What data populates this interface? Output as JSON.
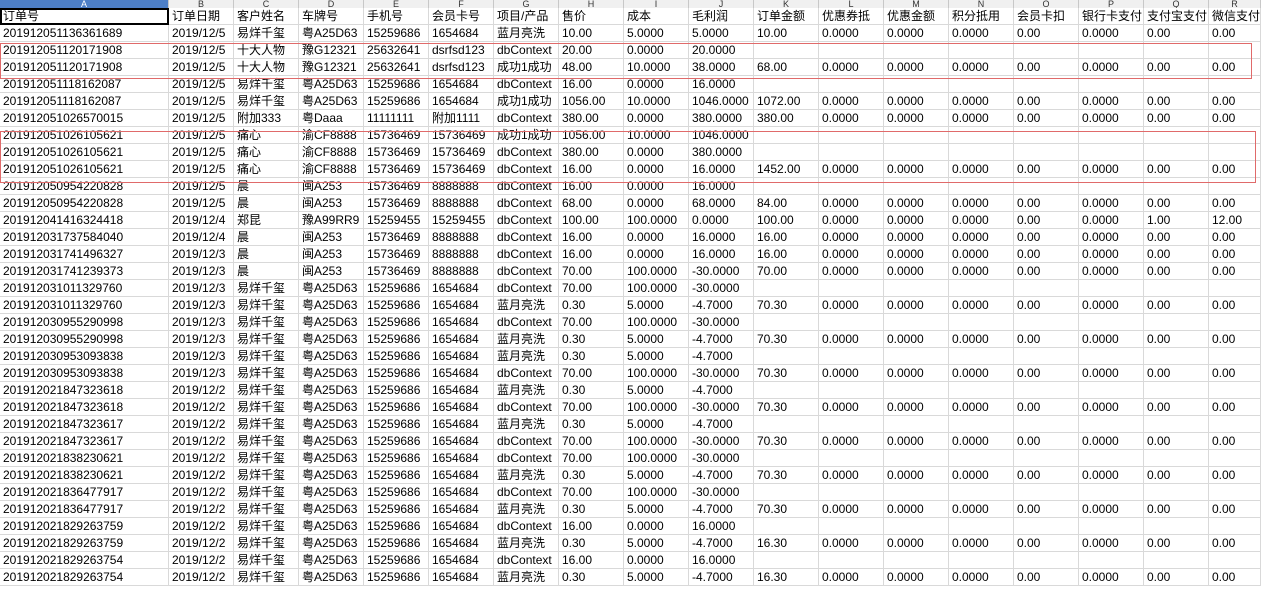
{
  "column_letters": [
    "A",
    "B",
    "C",
    "D",
    "E",
    "F",
    "G",
    "H",
    "I",
    "J",
    "K",
    "L",
    "M",
    "N",
    "O",
    "P",
    "Q",
    "R"
  ],
  "header_row": [
    "订单号",
    "订单日期",
    "客户姓名",
    "车牌号",
    "手机号",
    "会员卡号",
    "项目/产品",
    "售价",
    "成本",
    "毛利润",
    "订单金额",
    "优惠券抵",
    "优惠金额",
    "积分抵用",
    "会员卡扣",
    "银行卡支付",
    "支付宝支付",
    "微信支付"
  ],
  "rows": [
    [
      "201912051136361689",
      "2019/12/5",
      "易烊千玺",
      "粤A25D63",
      "15259686",
      "1654684",
      "蓝月亮洗",
      "10.00",
      "5.0000",
      "5.0000",
      "10.00",
      "0.0000",
      "0.0000",
      "0.0000",
      "0.00",
      "0.0000",
      "0.00",
      "0.00"
    ],
    [
      "201912051120171908",
      "2019/12/5",
      "十大人物",
      "豫G12321",
      "25632641",
      "dsrfsd123",
      "dbContext",
      "20.00",
      "0.0000",
      "20.0000",
      "",
      "",
      "",
      "",
      "",
      "",
      "",
      ""
    ],
    [
      "201912051120171908",
      "2019/12/5",
      "十大人物",
      "豫G12321",
      "25632641",
      "dsrfsd123",
      "成功1成功",
      "48.00",
      "10.0000",
      "38.0000",
      "68.00",
      "0.0000",
      "0.0000",
      "0.0000",
      "0.00",
      "0.0000",
      "0.00",
      "0.00"
    ],
    [
      "201912051118162087",
      "2019/12/5",
      "易烊千玺",
      "粤A25D63",
      "15259686",
      "1654684",
      "dbContext",
      "16.00",
      "0.0000",
      "16.0000",
      "",
      "",
      "",
      "",
      "",
      "",
      "",
      ""
    ],
    [
      "201912051118162087",
      "2019/12/5",
      "易烊千玺",
      "粤A25D63",
      "15259686",
      "1654684",
      "成功1成功",
      "1056.00",
      "10.0000",
      "1046.0000",
      "1072.00",
      "0.0000",
      "0.0000",
      "0.0000",
      "0.00",
      "0.0000",
      "0.00",
      "0.00"
    ],
    [
      "201912051026570015",
      "2019/12/5",
      "附加333",
      "粤Daaa",
      "11111111",
      "附加1111",
      "dbContext",
      "380.00",
      "0.0000",
      "380.0000",
      "380.00",
      "0.0000",
      "0.0000",
      "0.0000",
      "0.00",
      "0.0000",
      "0.00",
      "0.00"
    ],
    [
      "201912051026105621",
      "2019/12/5",
      "痛心",
      "渝CF8888",
      "15736469",
      "15736469",
      "成功1成功",
      "1056.00",
      "10.0000",
      "1046.0000",
      "",
      "",
      "",
      "",
      "",
      "",
      "",
      ""
    ],
    [
      "201912051026105621",
      "2019/12/5",
      "痛心",
      "渝CF8888",
      "15736469",
      "15736469",
      "dbContext",
      "380.00",
      "0.0000",
      "380.0000",
      "",
      "",
      "",
      "",
      "",
      "",
      "",
      ""
    ],
    [
      "201912051026105621",
      "2019/12/5",
      "痛心",
      "渝CF8888",
      "15736469",
      "15736469",
      "dbContext",
      "16.00",
      "0.0000",
      "16.0000",
      "1452.00",
      "0.0000",
      "0.0000",
      "0.0000",
      "0.00",
      "0.0000",
      "0.00",
      "0.00"
    ],
    [
      "201912050954220828",
      "2019/12/5",
      "晨",
      "闽A253",
      "15736469",
      "8888888",
      "dbContext",
      "16.00",
      "0.0000",
      "16.0000",
      "",
      "",
      "",
      "",
      "",
      "",
      "",
      ""
    ],
    [
      "201912050954220828",
      "2019/12/5",
      "晨",
      "闽A253",
      "15736469",
      "8888888",
      "dbContext",
      "68.00",
      "0.0000",
      "68.0000",
      "84.00",
      "0.0000",
      "0.0000",
      "0.0000",
      "0.00",
      "0.0000",
      "0.00",
      "0.00"
    ],
    [
      "201912041416324418",
      "2019/12/4",
      "郑昆",
      "豫A99RR9",
      "15259455",
      "15259455",
      "dbContext",
      "100.00",
      "100.0000",
      "0.0000",
      "100.00",
      "0.0000",
      "0.0000",
      "0.0000",
      "0.00",
      "0.0000",
      "1.00",
      "12.00"
    ],
    [
      "201912031737584040",
      "2019/12/4",
      "晨",
      "闽A253",
      "15736469",
      "8888888",
      "dbContext",
      "16.00",
      "0.0000",
      "16.0000",
      "16.00",
      "0.0000",
      "0.0000",
      "0.0000",
      "0.00",
      "0.0000",
      "0.00",
      "0.00"
    ],
    [
      "201912031741496327",
      "2019/12/3",
      "晨",
      "闽A253",
      "15736469",
      "8888888",
      "dbContext",
      "16.00",
      "0.0000",
      "16.0000",
      "16.00",
      "0.0000",
      "0.0000",
      "0.0000",
      "0.00",
      "0.0000",
      "0.00",
      "0.00"
    ],
    [
      "201912031741239373",
      "2019/12/3",
      "晨",
      "闽A253",
      "15736469",
      "8888888",
      "dbContext",
      "70.00",
      "100.0000",
      "-30.0000",
      "70.00",
      "0.0000",
      "0.0000",
      "0.0000",
      "0.00",
      "0.0000",
      "0.00",
      "0.00"
    ],
    [
      "201912031011329760",
      "2019/12/3",
      "易烊千玺",
      "粤A25D63",
      "15259686",
      "1654684",
      "dbContext",
      "70.00",
      "100.0000",
      "-30.0000",
      "",
      "",
      "",
      "",
      "",
      "",
      "",
      ""
    ],
    [
      "201912031011329760",
      "2019/12/3",
      "易烊千玺",
      "粤A25D63",
      "15259686",
      "1654684",
      "蓝月亮洗",
      "0.30",
      "5.0000",
      "-4.7000",
      "70.30",
      "0.0000",
      "0.0000",
      "0.0000",
      "0.00",
      "0.0000",
      "0.00",
      "0.00"
    ],
    [
      "201912030955290998",
      "2019/12/3",
      "易烊千玺",
      "粤A25D63",
      "15259686",
      "1654684",
      "dbContext",
      "70.00",
      "100.0000",
      "-30.0000",
      "",
      "",
      "",
      "",
      "",
      "",
      "",
      ""
    ],
    [
      "201912030955290998",
      "2019/12/3",
      "易烊千玺",
      "粤A25D63",
      "15259686",
      "1654684",
      "蓝月亮洗",
      "0.30",
      "5.0000",
      "-4.7000",
      "70.30",
      "0.0000",
      "0.0000",
      "0.0000",
      "0.00",
      "0.0000",
      "0.00",
      "0.00"
    ],
    [
      "201912030953093838",
      "2019/12/3",
      "易烊千玺",
      "粤A25D63",
      "15259686",
      "1654684",
      "蓝月亮洗",
      "0.30",
      "5.0000",
      "-4.7000",
      "",
      "",
      "",
      "",
      "",
      "",
      "",
      ""
    ],
    [
      "201912030953093838",
      "2019/12/3",
      "易烊千玺",
      "粤A25D63",
      "15259686",
      "1654684",
      "dbContext",
      "70.00",
      "100.0000",
      "-30.0000",
      "70.30",
      "0.0000",
      "0.0000",
      "0.0000",
      "0.00",
      "0.0000",
      "0.00",
      "0.00"
    ],
    [
      "201912021847323618",
      "2019/12/2",
      "易烊千玺",
      "粤A25D63",
      "15259686",
      "1654684",
      "蓝月亮洗",
      "0.30",
      "5.0000",
      "-4.7000",
      "",
      "",
      "",
      "",
      "",
      "",
      "",
      ""
    ],
    [
      "201912021847323618",
      "2019/12/2",
      "易烊千玺",
      "粤A25D63",
      "15259686",
      "1654684",
      "dbContext",
      "70.00",
      "100.0000",
      "-30.0000",
      "70.30",
      "0.0000",
      "0.0000",
      "0.0000",
      "0.00",
      "0.0000",
      "0.00",
      "0.00"
    ],
    [
      "201912021847323617",
      "2019/12/2",
      "易烊千玺",
      "粤A25D63",
      "15259686",
      "1654684",
      "蓝月亮洗",
      "0.30",
      "5.0000",
      "-4.7000",
      "",
      "",
      "",
      "",
      "",
      "",
      "",
      ""
    ],
    [
      "201912021847323617",
      "2019/12/2",
      "易烊千玺",
      "粤A25D63",
      "15259686",
      "1654684",
      "dbContext",
      "70.00",
      "100.0000",
      "-30.0000",
      "70.30",
      "0.0000",
      "0.0000",
      "0.0000",
      "0.00",
      "0.0000",
      "0.00",
      "0.00"
    ],
    [
      "201912021838230621",
      "2019/12/2",
      "易烊千玺",
      "粤A25D63",
      "15259686",
      "1654684",
      "dbContext",
      "70.00",
      "100.0000",
      "-30.0000",
      "",
      "",
      "",
      "",
      "",
      "",
      "",
      ""
    ],
    [
      "201912021838230621",
      "2019/12/2",
      "易烊千玺",
      "粤A25D63",
      "15259686",
      "1654684",
      "蓝月亮洗",
      "0.30",
      "5.0000",
      "-4.7000",
      "70.30",
      "0.0000",
      "0.0000",
      "0.0000",
      "0.00",
      "0.0000",
      "0.00",
      "0.00"
    ],
    [
      "201912021836477917",
      "2019/12/2",
      "易烊千玺",
      "粤A25D63",
      "15259686",
      "1654684",
      "dbContext",
      "70.00",
      "100.0000",
      "-30.0000",
      "",
      "",
      "",
      "",
      "",
      "",
      "",
      ""
    ],
    [
      "201912021836477917",
      "2019/12/2",
      "易烊千玺",
      "粤A25D63",
      "15259686",
      "1654684",
      "蓝月亮洗",
      "0.30",
      "5.0000",
      "-4.7000",
      "70.30",
      "0.0000",
      "0.0000",
      "0.0000",
      "0.00",
      "0.0000",
      "0.00",
      "0.00"
    ],
    [
      "201912021829263759",
      "2019/12/2",
      "易烊千玺",
      "粤A25D63",
      "15259686",
      "1654684",
      "dbContext",
      "16.00",
      "0.0000",
      "16.0000",
      "",
      "",
      "",
      "",
      "",
      "",
      "",
      ""
    ],
    [
      "201912021829263759",
      "2019/12/2",
      "易烊千玺",
      "粤A25D63",
      "15259686",
      "1654684",
      "蓝月亮洗",
      "0.30",
      "5.0000",
      "-4.7000",
      "16.30",
      "0.0000",
      "0.0000",
      "0.0000",
      "0.00",
      "0.0000",
      "0.00",
      "0.00"
    ],
    [
      "201912021829263754",
      "2019/12/2",
      "易烊千玺",
      "粤A25D63",
      "15259686",
      "1654684",
      "dbContext",
      "16.00",
      "0.0000",
      "16.0000",
      "",
      "",
      "",
      "",
      "",
      "",
      "",
      ""
    ],
    [
      "201912021829263754",
      "2019/12/2",
      "易烊千玺",
      "粤A25D63",
      "15259686",
      "1654684",
      "蓝月亮洗",
      "0.30",
      "5.0000",
      "-4.7000",
      "16.30",
      "0.0000",
      "0.0000",
      "0.0000",
      "0.00",
      "0.0000",
      "0.00",
      "0.00"
    ]
  ],
  "colors": {
    "highlight_box": "#e06a6a",
    "selected_column_header": "#4d7fc7",
    "grid": "#d9d9d9"
  }
}
